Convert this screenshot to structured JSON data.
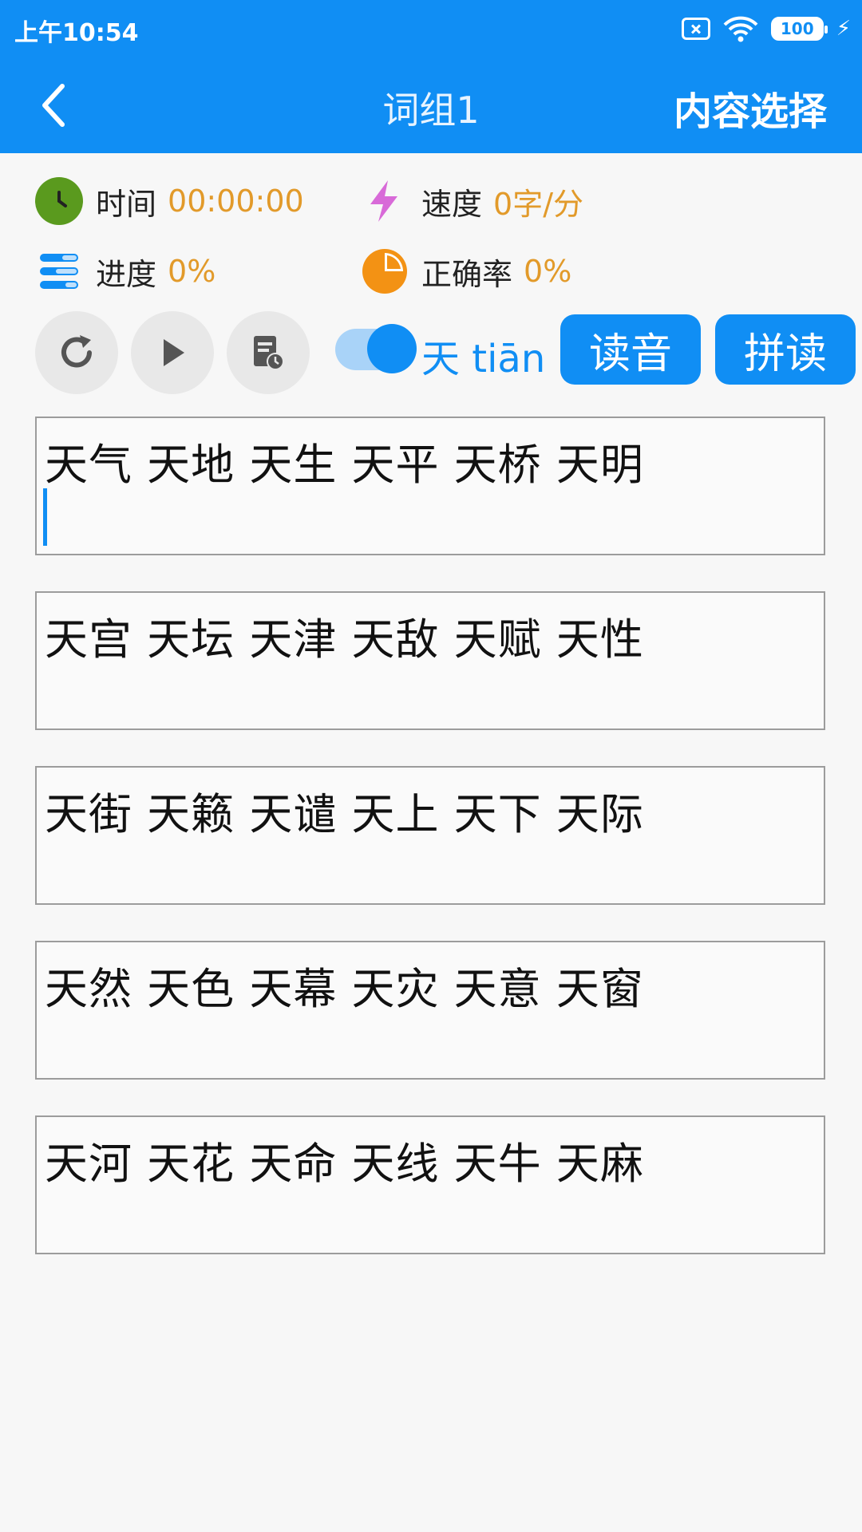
{
  "status_bar": {
    "time": "上午10:54",
    "battery": "100"
  },
  "header": {
    "title": "词组1",
    "action": "内容选择"
  },
  "stats": {
    "time_label": "时间",
    "time_value": "00:00:00",
    "speed_label": "速度",
    "speed_value": "0字/分",
    "progress_label": "进度",
    "progress_value": "0%",
    "accuracy_label": "正确率",
    "accuracy_value": "0%"
  },
  "controls": {
    "toggle_label": "天 tiān",
    "toggle_on": true,
    "read_button": "读音",
    "spell_button": "拼读"
  },
  "word_groups": [
    "天气 天地 天生 天平 天桥 天明",
    "天宫 天坛 天津 天敌 天赋 天性",
    "天街 天籁 天谴 天上 天下 天际",
    "天然 天色 天幕 天灾 天意 天窗",
    "天河 天花 天命 天线 天牛 天麻"
  ],
  "colors": {
    "primary": "#108ef4",
    "value_orange": "#e29a2a",
    "clock_green": "#5a9a1e",
    "bolt_purple": "#d86ad8",
    "pie_orange": "#f39214"
  }
}
